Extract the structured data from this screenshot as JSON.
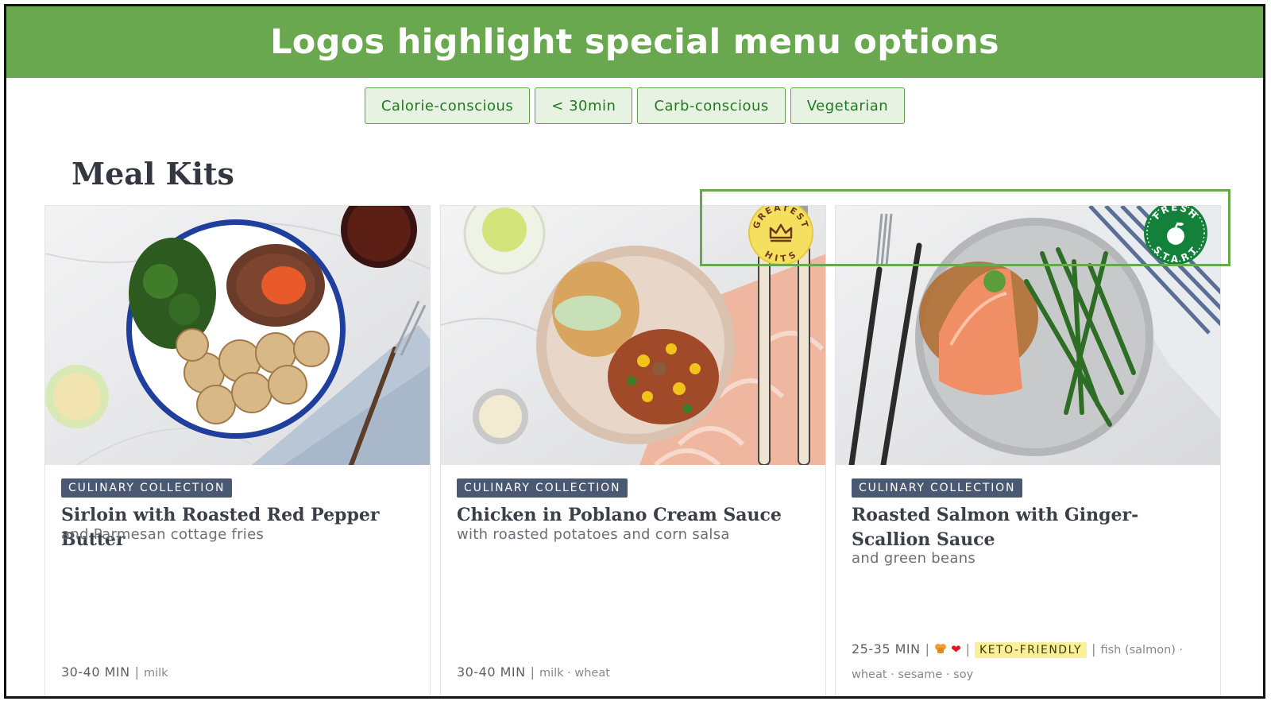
{
  "banner": {
    "title": "Logos highlight special menu options"
  },
  "filters": [
    {
      "label": "Calorie-conscious"
    },
    {
      "label": "< 30min"
    },
    {
      "label": "Carb-conscious"
    },
    {
      "label": "Vegetarian"
    }
  ],
  "section": {
    "title": "Meal Kits"
  },
  "cards": [
    {
      "tag": "CULINARY COLLECTION",
      "title": "Sirloin with Roasted Red Pepper Butter",
      "subtitle": "and Parmesan cottage fries",
      "time": "30-40 MIN",
      "allergens": "milk"
    },
    {
      "tag": "CULINARY COLLECTION",
      "title": "Chicken in Poblano Cream Sauce",
      "subtitle": "with roasted potatoes and corn salsa",
      "time": "30-40 MIN",
      "allergens": "milk · wheat",
      "badge": {
        "top": "GREATEST",
        "bottom": "HITS"
      }
    },
    {
      "tag": "CULINARY COLLECTION",
      "title": "Roasted Salmon with Ginger-Scallion Sauce",
      "subtitle": "and green beans",
      "time": "25-35 MIN",
      "diet": "KETO-FRIENDLY",
      "allergens_line1": "fish (salmon) ·",
      "allergens_line2": "wheat · sesame · soy",
      "badge": {
        "top": "FRESH",
        "bottom": "START"
      }
    }
  ],
  "colors": {
    "banner_green": "#6aa84f",
    "tag_slate": "#4a5872",
    "keto_yellow": "#fbef9a",
    "greatest_hits_yellow": "#f5df5e",
    "fresh_start_green": "#14813a"
  },
  "icons": [
    "crown-icon",
    "apple-icon",
    "fork-knife-icon",
    "heart-icon"
  ]
}
